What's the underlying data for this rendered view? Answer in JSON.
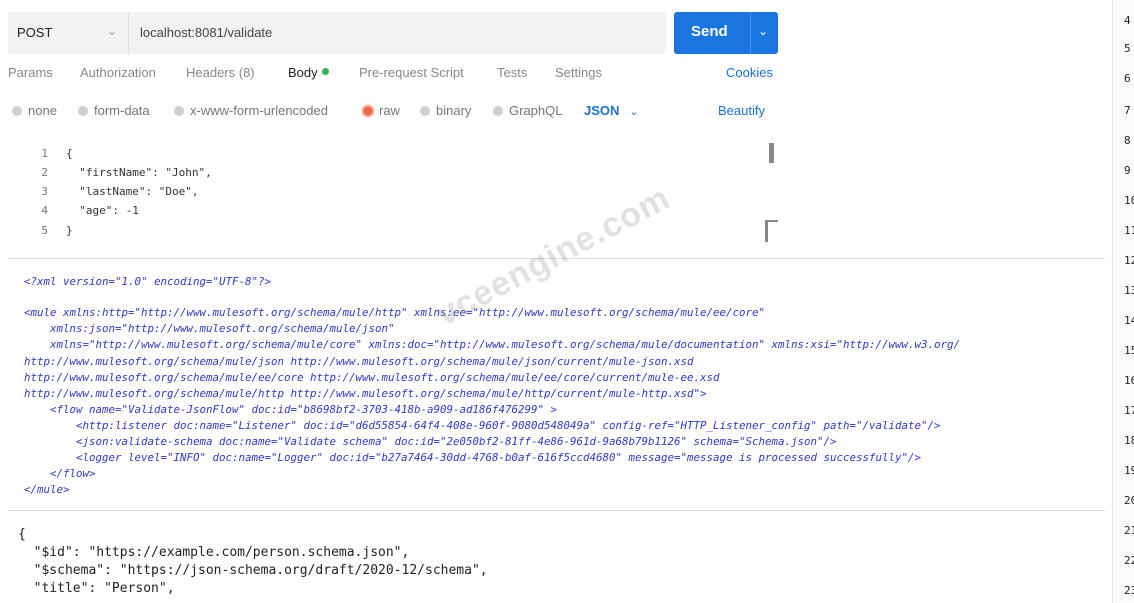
{
  "request": {
    "method": "POST",
    "url": "localhost:8081/validate",
    "send_label": "Send"
  },
  "tabs": [
    {
      "label": "Params"
    },
    {
      "label": "Authorization"
    },
    {
      "label": "Headers (8)"
    },
    {
      "label": "Body"
    },
    {
      "label": "Pre-request Script"
    },
    {
      "label": "Tests"
    },
    {
      "label": "Settings"
    }
  ],
  "cookies_label": "Cookies",
  "body_types": [
    {
      "label": "none",
      "selected": false
    },
    {
      "label": "form-data",
      "selected": false
    },
    {
      "label": "x-www-form-urlencoded",
      "selected": false
    },
    {
      "label": "raw",
      "selected": true
    },
    {
      "label": "binary",
      "selected": false
    },
    {
      "label": "GraphQL",
      "selected": false
    }
  ],
  "format_label": "JSON",
  "beautify_label": "Beautify",
  "editor": {
    "line_numbers": [
      "1",
      "2",
      "3",
      "4",
      "5"
    ],
    "lines": [
      "{",
      "  \"firstName\": \"John\",",
      "  \"lastName\": \"Doe\",",
      "  \"age\": -1",
      "}"
    ]
  },
  "xml": [
    "<?xml version=\"1.0\" encoding=\"UTF-8\"?>",
    "",
    "<mule xmlns:http=\"http://www.mulesoft.org/schema/mule/http\" xmlns:ee=\"http://www.mulesoft.org/schema/mule/ee/core\"",
    "    xmlns:json=\"http://www.mulesoft.org/schema/mule/json\"",
    "    xmlns=\"http://www.mulesoft.org/schema/mule/core\" xmlns:doc=\"http://www.mulesoft.org/schema/mule/documentation\" xmlns:xsi=\"http://www.w3.org/",
    "http://www.mulesoft.org/schema/mule/json http://www.mulesoft.org/schema/mule/json/current/mule-json.xsd",
    "http://www.mulesoft.org/schema/mule/ee/core http://www.mulesoft.org/schema/mule/ee/core/current/mule-ee.xsd",
    "http://www.mulesoft.org/schema/mule/http http://www.mulesoft.org/schema/mule/http/current/mule-http.xsd\">",
    "    <flow name=\"Validate-JsonFlow\" doc:id=\"b8698bf2-3703-418b-a909-ad186f476299\" >",
    "        <http:listener doc:name=\"Listener\" doc:id=\"d6d55854-64f4-408e-960f-9080d548049a\" config-ref=\"HTTP_Listener_config\" path=\"/validate\"/>",
    "        <json:validate-schema doc:name=\"Validate schema\" doc:id=\"2e050bf2-81ff-4e86-961d-9a68b79b1126\" schema=\"Schema.json\"/>",
    "        <logger level=\"INFO\" doc:name=\"Logger\" doc:id=\"b27a7464-30dd-4768-b0af-616f5ccd4680\" message=\"message is processed successfully\"/>",
    "    </flow>",
    "</mule>"
  ],
  "schema": [
    "{",
    "  \"$id\": \"https://example.com/person.schema.json\",",
    "  \"$schema\": \"https://json-schema.org/draft/2020-12/schema\",",
    "  \"title\": \"Person\","
  ],
  "watermark": "vceengine.com",
  "edge_numbers": [
    "4",
    "5",
    "6",
    "7",
    "8",
    "9",
    "10",
    "11",
    "12",
    "13",
    "14",
    "15",
    "16",
    "17",
    "18",
    "19",
    "20",
    "21",
    "22",
    "23"
  ]
}
